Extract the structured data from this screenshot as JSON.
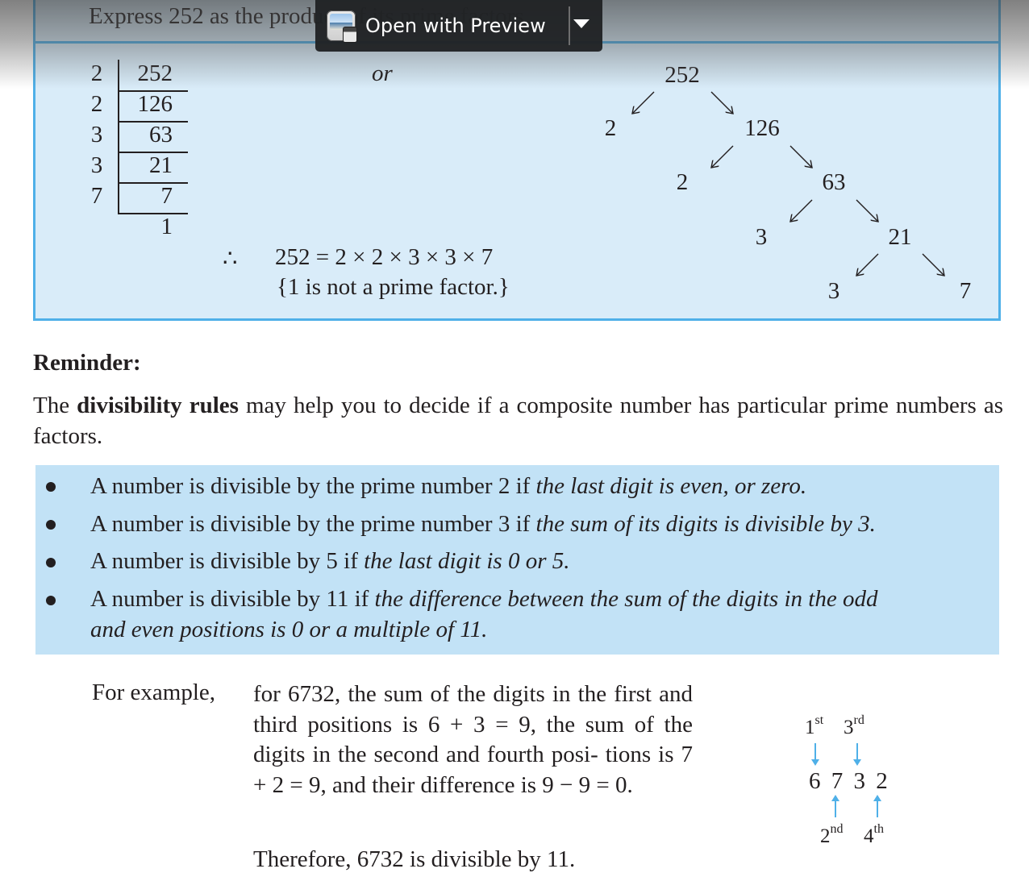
{
  "example": {
    "title": "Express 252 as the product of its prime factors",
    "division_ladder": [
      {
        "divisor": "2",
        "value": "252"
      },
      {
        "divisor": "2",
        "value": "126"
      },
      {
        "divisor": "3",
        "value": "63"
      },
      {
        "divisor": "3",
        "value": "21"
      },
      {
        "divisor": "7",
        "value": "7"
      }
    ],
    "ladder_remainder": "1",
    "or_label": "or",
    "therefore_symbol": "∴",
    "result": "252 = 2 × 2 × 3 × 3 × 7",
    "note": "{1 is not a prime factor.}",
    "factor_tree": {
      "nodes": [
        "252",
        "2",
        "126",
        "2",
        "63",
        "3",
        "21",
        "3",
        "7"
      ]
    }
  },
  "reminder": {
    "heading": "Reminder:",
    "intro_before": "The ",
    "intro_bold": "divisibility rules",
    "intro_after": " may help you to decide if a composite number has particular prime numbers as factors.",
    "rules": [
      {
        "plain": "A number is divisible by the prime number 2 if ",
        "italic": "the last digit is even, or zero."
      },
      {
        "plain": "A number is divisible by the prime number 3 if ",
        "italic": "the sum of its digits is divisible by 3."
      },
      {
        "plain": "A number is divisible by 5 if ",
        "italic": "the last digit is 0 or 5."
      },
      {
        "plain": "A number is divisible by 11 if ",
        "italic": "the difference between the sum of the digits in the odd",
        "italic2": "and even positions is 0 or a multiple of 11."
      }
    ]
  },
  "worked_example": {
    "lead": "For example,",
    "body": "for 6732, the sum of the digits in the first and third positions is 6 + 3 = 9, the sum of the digits in the second and fourth posi- tions is 7 + 2 = 9, and their difference is 9 − 9 = 0.",
    "conclusion": "Therefore, 6732 is divisible by 11.",
    "digits": "6 7 3 2",
    "position_labels": {
      "first": {
        "n": "1",
        "suffix": "st"
      },
      "second": {
        "n": "2",
        "suffix": "nd"
      },
      "third": {
        "n": "3",
        "suffix": "rd"
      },
      "fourth": {
        "n": "4",
        "suffix": "th"
      }
    }
  },
  "preview_button": {
    "label": "Open with Preview"
  },
  "colors": {
    "box_border": "#4fb0e8",
    "box_fill": "#d9ecf9",
    "rules_fill": "#c2e2f6",
    "text": "#231f20"
  }
}
